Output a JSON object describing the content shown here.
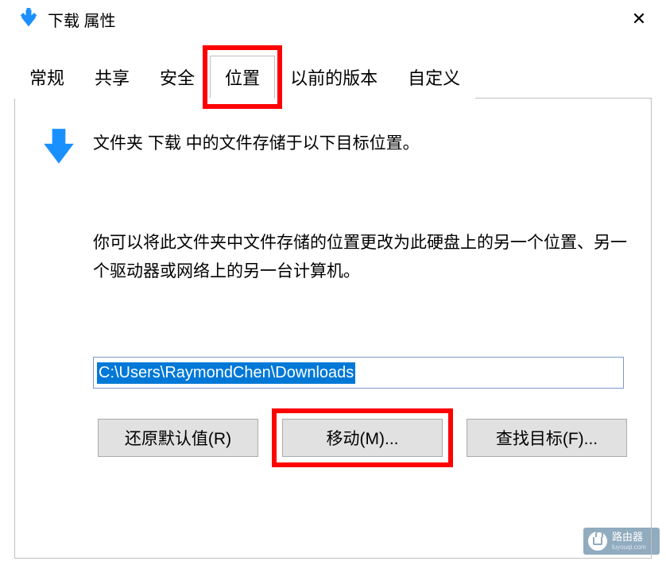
{
  "titlebar": {
    "title": "下载 属性"
  },
  "tabs": {
    "general": "常规",
    "share": "共享",
    "security": "安全",
    "location": "位置",
    "previous": "以前的版本",
    "custom": "自定义"
  },
  "content": {
    "header": "文件夹 下载 中的文件存储于以下目标位置。",
    "description": "你可以将此文件夹中文件存储的位置更改为此硬盘上的另一个位置、另一个驱动器或网络上的另一台计算机。",
    "path": "C:\\Users\\RaymondChen\\Downloads"
  },
  "buttons": {
    "restore": "还原默认值(R)",
    "move": "移动(M)...",
    "find": "查找目标(F)..."
  },
  "watermark": {
    "label": "路由器",
    "sub": "luyouqi.com"
  }
}
